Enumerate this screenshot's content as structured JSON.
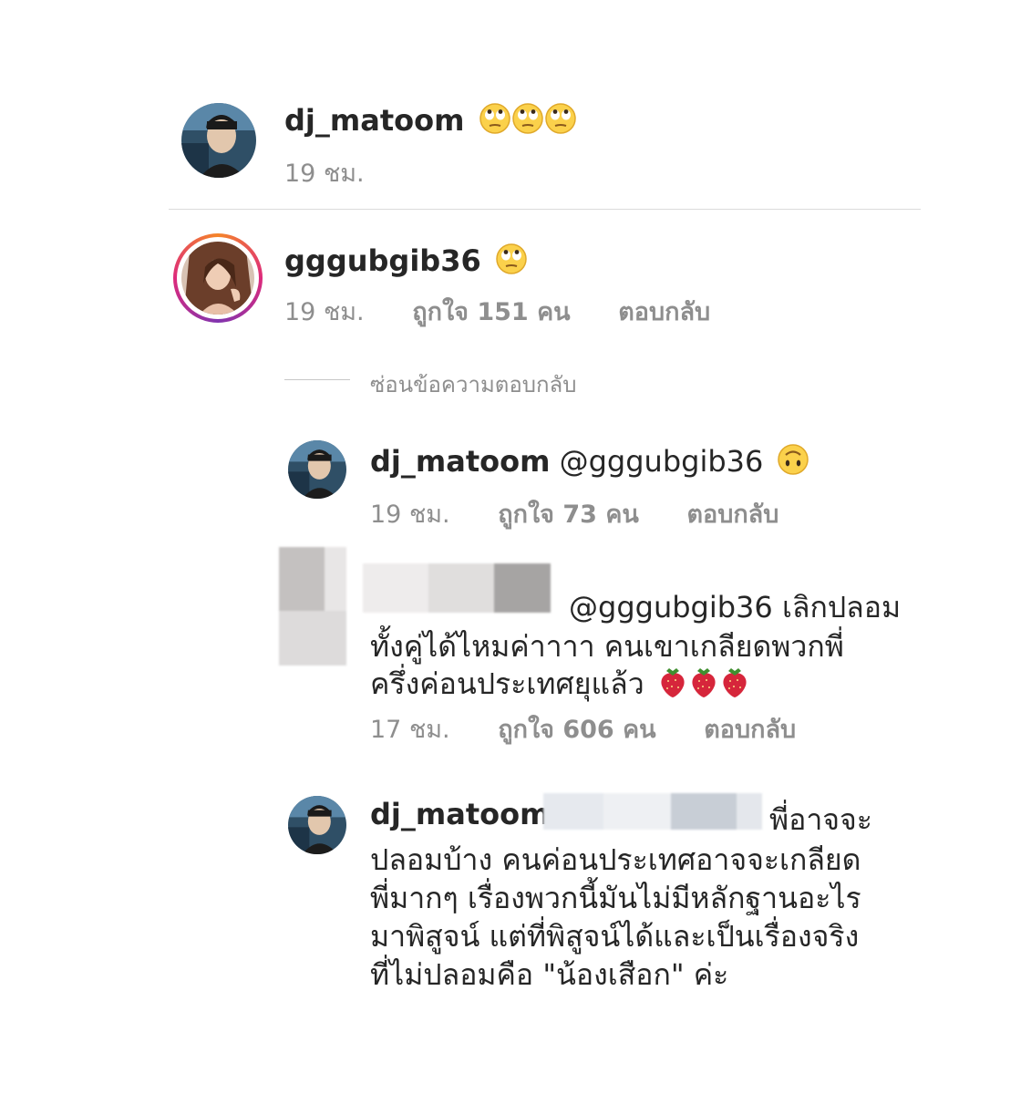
{
  "comments": [
    {
      "username": "dj_matoom",
      "text": "",
      "time": "19 ชม."
    },
    {
      "username": "gggubgib36",
      "time": "19 ชม.",
      "likes": "ถูกใจ 151 คน",
      "reply": "ตอบกลับ"
    }
  ],
  "hide_replies": "ซ่อนข้อความตอบกลับ",
  "replies": [
    {
      "username": "dj_matoom",
      "mention": "@gggubgib36",
      "time": "19 ชม.",
      "likes": "ถูกใจ 73 คน",
      "reply": "ตอบกลับ"
    },
    {
      "username": "",
      "mention": "@gggubgib36",
      "line1": "เลิกปลอม",
      "line2": "ทั้งคู่ได้ไหมค่าาาา คนเขาเกลียดพวกพี่",
      "line3": "ครึ่งค่อนประเทศยุแล้ว",
      "time": "17 ชม.",
      "likes": "ถูกใจ 606 คน",
      "reply": "ตอบกลับ"
    },
    {
      "username": "dj_matoom",
      "line0": "พี่อาจจะ",
      "line1": "ปลอมบ้าง คนค่อนประเทศอาจจะเกลียด",
      "line2": "พี่มากๆ เรื่องพวกนี้มันไม่มีหลักฐานอะไร",
      "line3": "มาพิสูจน์ แต่ที่พิสูจน์ได้และเป็นเรื่องจริง",
      "line4": "ที่ไม่ปลอมคือ \"น้องเสือก\" ค่ะ"
    }
  ],
  "icons": {
    "eye_roll": "face-with-rolling-eyes-icon",
    "upside_down": "upside-down-face-icon",
    "strawberry": "strawberry-icon"
  },
  "colors": {
    "text": "#262626",
    "meta": "#8e8e8e",
    "divider": "#dbdbdb"
  }
}
